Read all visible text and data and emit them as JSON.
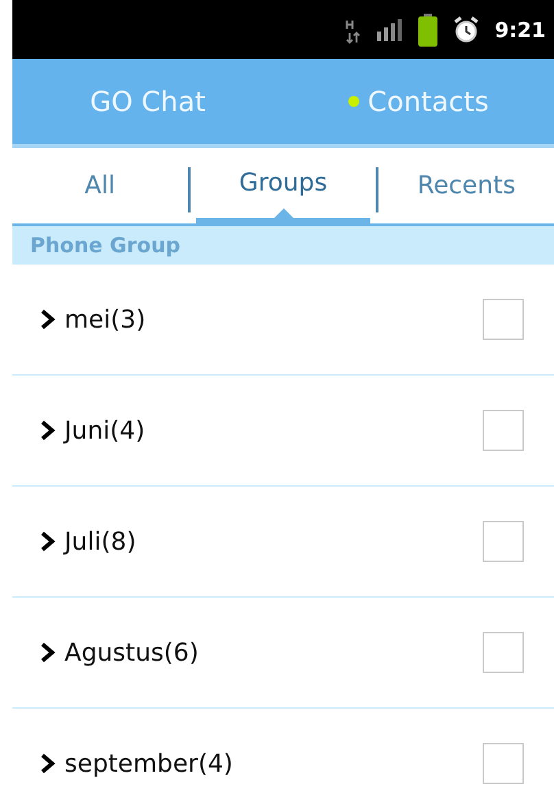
{
  "status_bar": {
    "time": "9:21"
  },
  "header": {
    "items": [
      {
        "label": "GO Chat",
        "online": false
      },
      {
        "label": "Contacts",
        "online": true
      }
    ]
  },
  "tabs": [
    {
      "label": "All",
      "selected": false
    },
    {
      "label": "Groups",
      "selected": true
    },
    {
      "label": "Recents",
      "selected": false
    }
  ],
  "section": {
    "title": "Phone Group"
  },
  "groups": [
    {
      "name": "mei(3)",
      "expanded": false,
      "checked": false
    },
    {
      "name": "Juni(4)",
      "expanded": false,
      "checked": false
    },
    {
      "name": "Juli(8)",
      "expanded": false,
      "checked": false
    },
    {
      "name": "Agustus(6)",
      "expanded": false,
      "checked": false
    },
    {
      "name": "september(4)",
      "expanded": false,
      "checked": false
    }
  ]
}
